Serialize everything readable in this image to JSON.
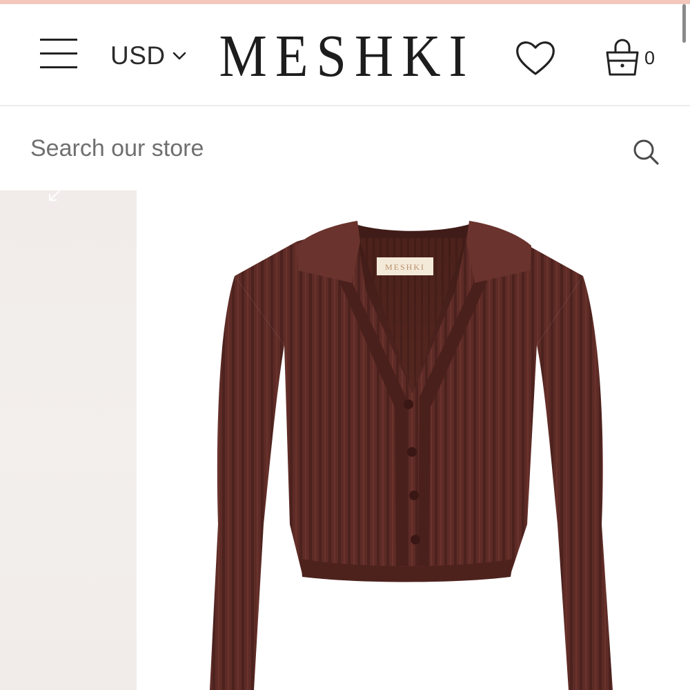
{
  "header": {
    "menu_icon": "hamburger-menu-icon",
    "currency": {
      "label": "USD",
      "icon": "chevron-down-icon"
    },
    "logo_text": "MESHKI",
    "wishlist_icon": "heart-icon",
    "cart": {
      "icon": "shopping-bag-icon",
      "count": "0"
    }
  },
  "search": {
    "placeholder": "Search our store",
    "value": "",
    "icon": "search-icon"
  },
  "gallery": {
    "expand_icon": "expand-arrow-icon",
    "product_image": "brown ribbed knit cropped cardigan with collar",
    "label_text": "MESHKI"
  },
  "colors": {
    "top_strip": "#f3c7bb",
    "product": "#5e2b26",
    "thumb_bg": "#f1ecea"
  }
}
